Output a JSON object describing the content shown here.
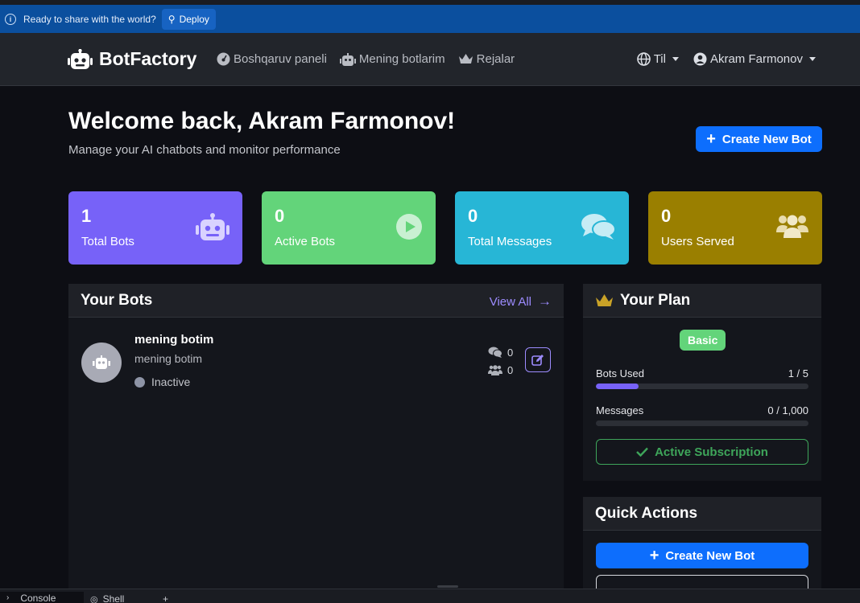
{
  "deploy_bar": {
    "message": "Ready to share with the world?",
    "button_label": "Deploy"
  },
  "navbar": {
    "brand": "BotFactory",
    "links": [
      {
        "label": "Boshqaruv paneli",
        "icon": "dashboard-icon"
      },
      {
        "label": "Mening botlarim",
        "icon": "robot-icon"
      },
      {
        "label": "Rejalar",
        "icon": "crown-icon"
      }
    ],
    "language_label": "Til",
    "user_name": "Akram Farmonov"
  },
  "header": {
    "welcome": "Welcome back, Akram Farmonov!",
    "subtitle": "Manage your AI chatbots and monitor performance",
    "create_button": "Create New Bot"
  },
  "stats": [
    {
      "value": "1",
      "label": "Total Bots",
      "color": "#7762f8",
      "icon": "robot-icon"
    },
    {
      "value": "0",
      "label": "Active Bots",
      "color": "#63d47a",
      "icon": "play-circle-icon"
    },
    {
      "value": "0",
      "label": "Total Messages",
      "color": "#27b6d6",
      "icon": "comments-icon"
    },
    {
      "value": "0",
      "label": "Users Served",
      "color": "#9a7f00",
      "icon": "users-icon"
    }
  ],
  "your_bots": {
    "title": "Your Bots",
    "view_all": "View All",
    "bots": [
      {
        "name": "mening botim",
        "description": "mening botim",
        "status": "Inactive",
        "messages": "0",
        "users": "0"
      }
    ]
  },
  "plan": {
    "title": "Your Plan",
    "badge": "Basic",
    "bots_used_label": "Bots Used",
    "bots_used_value": "1 / 5",
    "bots_used_fraction": 0.2,
    "messages_label": "Messages",
    "messages_value": "0 / 1,000",
    "messages_fraction": 0,
    "subscription_label": "Active Subscription"
  },
  "quick_actions": {
    "title": "Quick Actions",
    "create_button": "Create New Bot"
  },
  "console_tabs": {
    "console": "Console",
    "shell": "Shell",
    "add": "+"
  }
}
